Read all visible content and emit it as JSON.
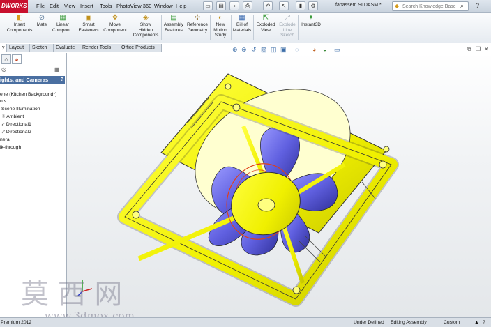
{
  "app": {
    "logo": "DWORKS",
    "brand_color": "#c8102e",
    "document_name": "fanassem.SLDASM *"
  },
  "menu": [
    "File",
    "Edit",
    "View",
    "Insert",
    "Tools",
    "PhotoView 360",
    "Window",
    "Help"
  ],
  "search": {
    "placeholder": "Search Knowledge Base"
  },
  "ribbon": [
    {
      "label": "Insert\nComponents",
      "icon": "insert-components-icon",
      "enabled": true
    },
    {
      "label": "Mate",
      "icon": "mate-icon",
      "enabled": true
    },
    {
      "label": "Linear\nCompon...",
      "icon": "linear-pattern-icon",
      "enabled": true
    },
    {
      "label": "Smart\nFasteners",
      "icon": "smart-fasteners-icon",
      "enabled": true
    },
    {
      "label": "Move\nComponent",
      "icon": "move-component-icon",
      "enabled": true
    },
    {
      "label": "Show\nHidden\nComponents",
      "icon": "show-hidden-icon",
      "enabled": true
    },
    {
      "label": "Assembly\nFeatures",
      "icon": "assembly-features-icon",
      "enabled": true
    },
    {
      "label": "Reference\nGeometry",
      "icon": "reference-geometry-icon",
      "enabled": true
    },
    {
      "label": "New\nMotion\nStudy",
      "icon": "motion-study-icon",
      "enabled": true
    },
    {
      "label": "Bill of\nMaterials",
      "icon": "bom-icon",
      "enabled": true
    },
    {
      "label": "Exploded\nView",
      "icon": "exploded-view-icon",
      "enabled": true
    },
    {
      "label": "Explode\nLine\nSketch",
      "icon": "explode-line-icon",
      "enabled": false
    },
    {
      "label": "Instant3D",
      "icon": "instant3d-icon",
      "enabled": true
    }
  ],
  "tabs": [
    {
      "label": "y",
      "active": true
    },
    {
      "label": "Layout",
      "active": false
    },
    {
      "label": "Sketch",
      "active": false
    },
    {
      "label": "Evaluate",
      "active": false
    },
    {
      "label": "Render Tools",
      "active": false
    },
    {
      "label": "Office Products",
      "active": false
    }
  ],
  "panel": {
    "title": "ights, and Cameras",
    "title_icon": "help-icon",
    "tree": [
      {
        "label": "ene (Kitchen Background*)",
        "icon": ""
      },
      {
        "label": "nts",
        "icon": ""
      },
      {
        "label": "Scene Illumination",
        "icon": "light-icon"
      },
      {
        "label": "Ambient",
        "icon": "light-icon"
      },
      {
        "label": "Directional1",
        "icon": "directional-light-icon"
      },
      {
        "label": "Directional2",
        "icon": "directional-light-icon"
      },
      {
        "label": "nera",
        "icon": ""
      },
      {
        "label": "lk-through",
        "icon": ""
      }
    ]
  },
  "model": {
    "frame_color": "#f2f200",
    "blade_color": "#6a6ae0",
    "highlight_color": "#e0401a"
  },
  "status": {
    "left": "Premium 2012",
    "under_defined": "Under Defined",
    "mode": "Editing Assembly",
    "units": "Custom"
  },
  "watermark": {
    "title": "莫 西 网",
    "url": "www.3dmox.com"
  }
}
